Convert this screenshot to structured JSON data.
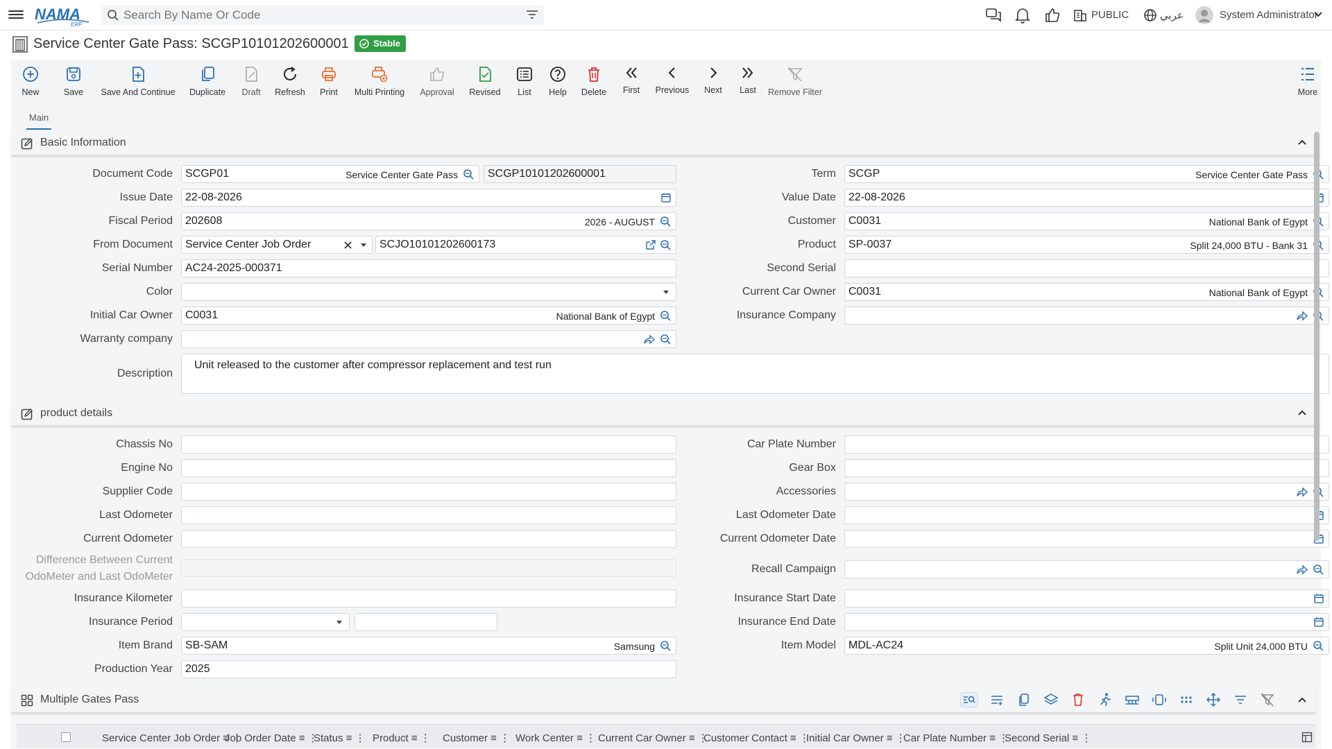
{
  "header": {
    "search_placeholder": "Search By Name Or Code",
    "public_label": "PUBLIC",
    "language_label": "عربي",
    "user_name": "System Administrator"
  },
  "page": {
    "title": "Service Center Gate Pass: SCGP10101202600001",
    "status": "Stable"
  },
  "toolbar": {
    "new": "New",
    "save": "Save",
    "save_continue": "Save And Continue",
    "duplicate": "Duplicate",
    "draft": "Draft",
    "refresh": "Refresh",
    "print": "Print",
    "multi_printing": "Multi Printing",
    "approval": "Approval",
    "revised": "Revised",
    "list": "List",
    "help": "Help",
    "delete": "Delete",
    "first": "First",
    "previous": "Previous",
    "next": "Next",
    "last": "Last",
    "remove_filter": "Remove Filter",
    "more": "More"
  },
  "tabs": {
    "main": "Main"
  },
  "basic": {
    "section_title": "Basic Information",
    "document_code": {
      "label": "Document Code",
      "value": "SCGP01",
      "desc": "Service Center Gate Pass",
      "number": "SCGP10101202600001"
    },
    "issue_date": {
      "label": "Issue Date",
      "value": "22-08-2026"
    },
    "fiscal_period": {
      "label": "Fiscal Period",
      "value": "202608",
      "desc": "2026 - AUGUST"
    },
    "from_document": {
      "label": "From Document",
      "type": "Service Center Job Order",
      "value": "SCJO10101202600173"
    },
    "serial_number": {
      "label": "Serial Number",
      "value": "AC24-2025-000371"
    },
    "color": {
      "label": "Color",
      "value": ""
    },
    "initial_car_owner": {
      "label": "Initial Car Owner",
      "value": "C0031",
      "desc": "National Bank of Egypt"
    },
    "warranty_company": {
      "label": "Warranty company",
      "value": ""
    },
    "description": {
      "label": "Description",
      "value": "Unit released to the customer after compressor replacement and test run"
    },
    "term": {
      "label": "Term",
      "value": "SCGP",
      "desc": "Service Center Gate Pass"
    },
    "value_date": {
      "label": "Value Date",
      "value": "22-08-2026"
    },
    "customer": {
      "label": "Customer",
      "value": "C0031",
      "desc": "National Bank of Egypt"
    },
    "product": {
      "label": "Product",
      "value": "SP-0037",
      "desc": "Split 24,000 BTU - Bank 31"
    },
    "second_serial": {
      "label": "Second Serial",
      "value": ""
    },
    "current_car_owner": {
      "label": "Current Car Owner",
      "value": "C0031",
      "desc": "National Bank of Egypt"
    },
    "insurance_company": {
      "label": "Insurance Company",
      "value": ""
    }
  },
  "product": {
    "section_title": "product details",
    "chassis_no": {
      "label": "Chassis No",
      "value": ""
    },
    "engine_no": {
      "label": "Engine No",
      "value": ""
    },
    "supplier_code": {
      "label": "Supplier Code",
      "value": ""
    },
    "last_odometer": {
      "label": "Last Odometer",
      "value": ""
    },
    "current_odometer": {
      "label": "Current Odometer",
      "value": ""
    },
    "difference_line1": "Difference Between Current",
    "difference_line2": "OdoMeter and Last OdoMeter",
    "insurance_kilometer": {
      "label": "Insurance Kilometer",
      "value": ""
    },
    "insurance_period": {
      "label": "Insurance Period",
      "value": ""
    },
    "item_brand": {
      "label": "Item Brand",
      "value": "SB-SAM",
      "desc": "Samsung"
    },
    "production_year": {
      "label": "Production Year",
      "value": "2025"
    },
    "car_plate_number": {
      "label": "Car Plate Number",
      "value": ""
    },
    "gear_box": {
      "label": "Gear Box",
      "value": ""
    },
    "accessories": {
      "label": "Accessories",
      "value": ""
    },
    "last_odometer_date": {
      "label": "Last Odometer Date",
      "value": ""
    },
    "current_odometer_date": {
      "label": "Current Odometer Date",
      "value": ""
    },
    "recall_campaign": {
      "label": "Recall Campaign",
      "value": ""
    },
    "insurance_start_date": {
      "label": "Insurance Start Date",
      "value": ""
    },
    "insurance_end_date": {
      "label": "Insurance End Date",
      "value": ""
    },
    "item_model": {
      "label": "Item Model",
      "value": "MDL-AC24",
      "desc": "Split Unit 24,000 BTU"
    }
  },
  "gates": {
    "section_title": "Multiple Gates Pass",
    "columns": [
      "Service Center Job Order",
      "Job Order Date",
      "Status",
      "Product",
      "Customer",
      "Work Center",
      "Current Car Owner",
      "Customer Contact",
      "Initial Car Owner",
      "Car Plate Number",
      "Second Serial"
    ]
  },
  "colors": {
    "accent": "#2c6fb7",
    "status": "#2f9e44",
    "print": "#e8702a",
    "delete": "#d9342b"
  }
}
